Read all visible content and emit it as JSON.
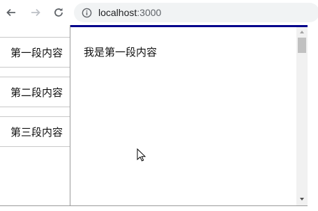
{
  "browser": {
    "url_host": "localhost",
    "url_port": ":3000"
  },
  "nav": {
    "items": [
      {
        "label": "第一段内容"
      },
      {
        "label": "第二段内容"
      },
      {
        "label": "第三段内容"
      }
    ]
  },
  "content": {
    "text": "我是第一段内容"
  },
  "colors": {
    "accent_border": "#00008b",
    "omnibox_bg": "#f1f3f4"
  }
}
